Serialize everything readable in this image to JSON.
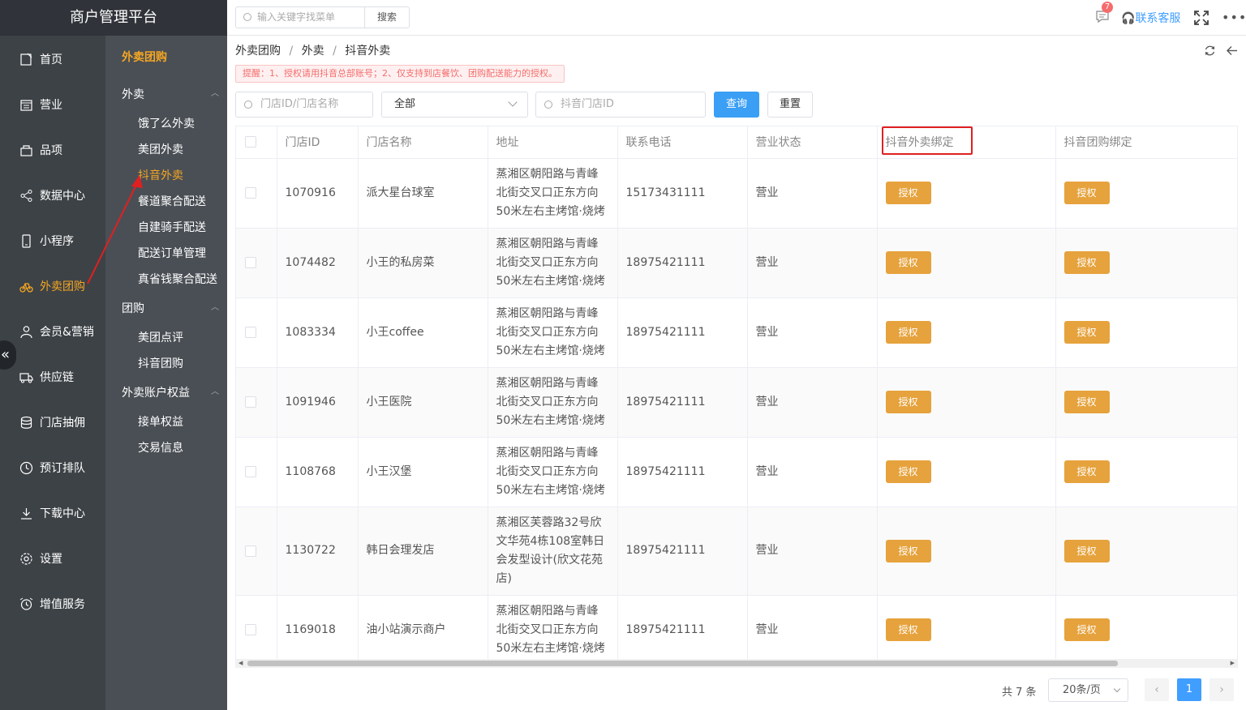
{
  "brand": "商户管理平台",
  "leftnav": [
    {
      "label": "首页",
      "icon": "home-icon"
    },
    {
      "label": "营业",
      "icon": "calendar-icon"
    },
    {
      "label": "品项",
      "icon": "bag-icon"
    },
    {
      "label": "数据中心",
      "icon": "share-icon"
    },
    {
      "label": "小程序",
      "icon": "phone-icon"
    },
    {
      "label": "外卖团购",
      "icon": "bike-icon",
      "active": true
    },
    {
      "label": "会员&营销",
      "icon": "user-icon"
    },
    {
      "label": "供应链",
      "icon": "truck-icon"
    },
    {
      "label": "门店抽佣",
      "icon": "database-icon"
    },
    {
      "label": "预订排队",
      "icon": "clock-icon"
    },
    {
      "label": "下载中心",
      "icon": "download-icon"
    },
    {
      "label": "设置",
      "icon": "gear-icon"
    },
    {
      "label": "增值服务",
      "icon": "alarm-icon"
    }
  ],
  "collapse": "«",
  "subnav": {
    "title": "外卖团购",
    "groups": [
      {
        "label": "外卖",
        "caret": "︿"
      },
      {
        "label": "团购",
        "caret": "︿"
      },
      {
        "label": "外卖账户权益",
        "caret": "︿"
      }
    ],
    "items": [
      "饿了么外卖",
      "美团外卖",
      "抖音外卖",
      "餐道聚合配送",
      "自建骑手配送",
      "配送订单管理",
      "真省钱聚合配送",
      "美团点评",
      "抖音团购",
      "接单权益",
      "交易信息"
    ]
  },
  "topbar": {
    "search_placeholder": "输入关键字找菜单",
    "search_button": "搜索",
    "msg_count": "7",
    "service": "联系客服",
    "more": "•••"
  },
  "breadcrumb": [
    "外卖团购",
    "外卖",
    "抖音外卖"
  ],
  "breadcrumb_sep": "/",
  "tip": "提醒：1、授权请用抖音总部账号；2、仅支持到店餐饮、团购配送能力的授权。",
  "filters": {
    "store_placeholder": "门店ID/门店名称",
    "status_value": "全部",
    "douyin_placeholder": "抖音门店ID",
    "query": "查询",
    "reset": "重置"
  },
  "table": {
    "headers": [
      "门店ID",
      "门店名称",
      "地址",
      "联系电话",
      "营业状态",
      "抖音外卖绑定",
      "抖音团购绑定"
    ],
    "auth_label": "授权",
    "rows": [
      {
        "id": "1070916",
        "name": "派大星台球室",
        "address": "蒸湘区朝阳路与青峰北街交叉口正东方向50米左右主烤馆·烧烤",
        "phone": "15173431111",
        "status": "营业"
      },
      {
        "id": "1074482",
        "name": "小王的私房菜",
        "address": "蒸湘区朝阳路与青峰北街交叉口正东方向50米左右主烤馆·烧烤",
        "phone": "18975421111",
        "status": "营业"
      },
      {
        "id": "1083334",
        "name": "小王coffee",
        "address": "蒸湘区朝阳路与青峰北街交叉口正东方向50米左右主烤馆·烧烤",
        "phone": "18975421111",
        "status": "营业"
      },
      {
        "id": "1091946",
        "name": "小王医院",
        "address": "蒸湘区朝阳路与青峰北街交叉口正东方向50米左右主烤馆·烧烤",
        "phone": "18975421111",
        "status": "营业"
      },
      {
        "id": "1108768",
        "name": "小王汉堡",
        "address": "蒸湘区朝阳路与青峰北街交叉口正东方向50米左右主烤馆·烧烤",
        "phone": "18975421111",
        "status": "营业"
      },
      {
        "id": "1130722",
        "name": "韩日会理发店",
        "address": "蒸湘区芙蓉路32号欣文华苑4栋108室韩日会发型设计(欣文花苑店)",
        "phone": "18975421111",
        "status": "营业"
      },
      {
        "id": "1169018",
        "name": "油小站演示商户",
        "address": "蒸湘区朝阳路与青峰北街交叉口正东方向50米左右主烤馆·烧烤",
        "phone": "18975421111",
        "status": "营业"
      }
    ]
  },
  "pagination": {
    "total": "共 7 条",
    "page_size": "20条/页",
    "prev": "‹",
    "current": "1",
    "next": "›"
  },
  "colors": {
    "accent": "#f5a623",
    "primary": "#409eff",
    "auth": "#e6a23c",
    "highlight": "#e02020"
  }
}
